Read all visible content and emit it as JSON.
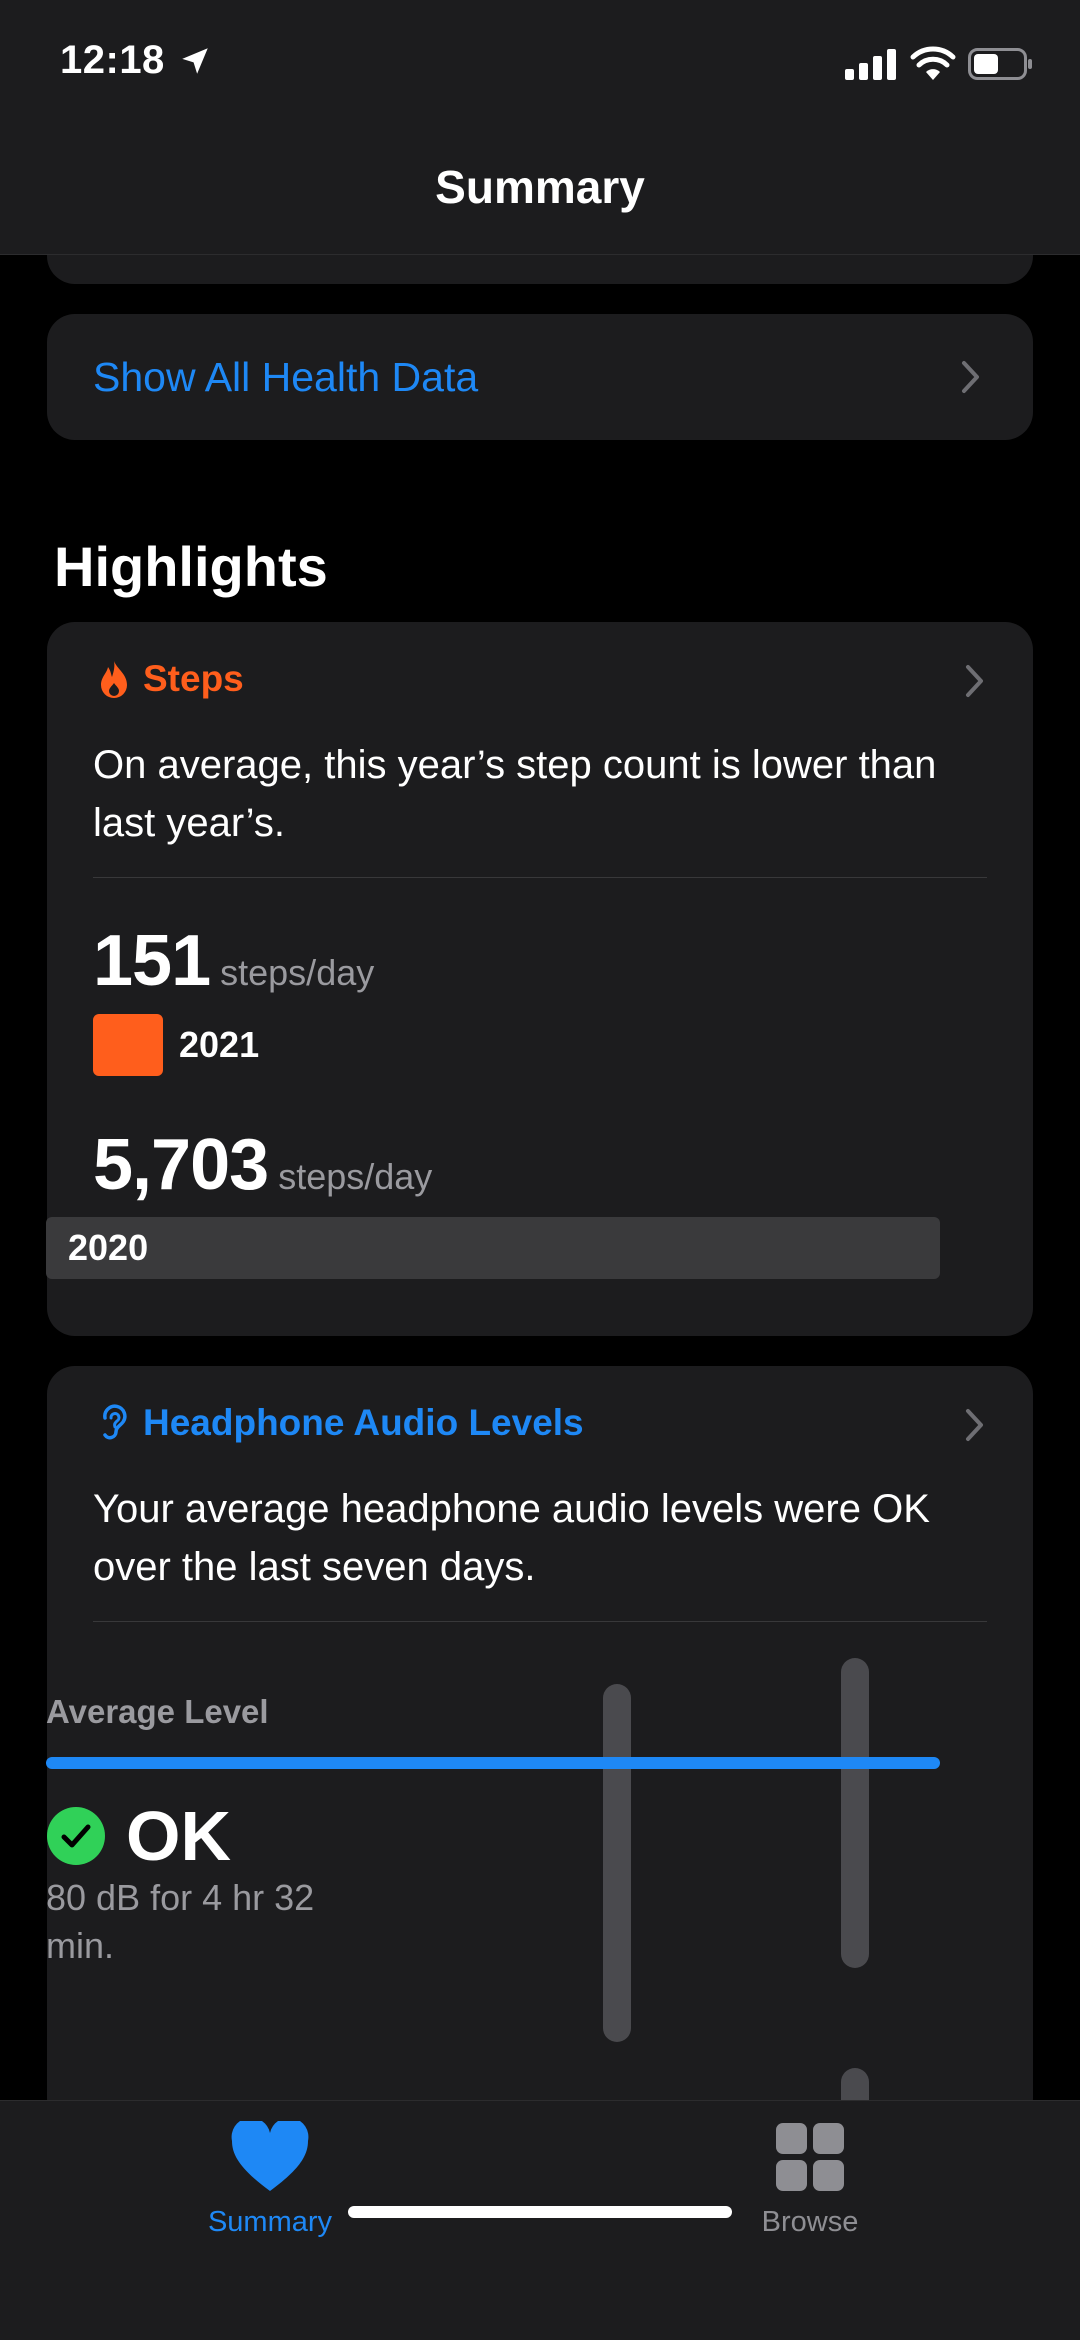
{
  "status_bar": {
    "time": "12:18"
  },
  "nav": {
    "title": "Summary"
  },
  "show_all": {
    "label": "Show All Health Data"
  },
  "highlights": {
    "title": "Highlights",
    "steps": {
      "title": "Steps",
      "description": "On average, this year’s step count is lower than last year’s.",
      "current": {
        "value": "151",
        "unit": "steps/day",
        "year": "2021"
      },
      "previous": {
        "value": "5,703",
        "unit": "steps/day",
        "year": "2020"
      },
      "accent": "#ff5e1c"
    },
    "audio": {
      "title": "Headphone Audio Levels",
      "description": "Your average headphone audio levels were OK over the last seven days.",
      "average_label": "Average Level",
      "status": "OK",
      "detail": "80 dB for 4 hr 32 min.",
      "accent": "#1e88f5"
    }
  },
  "tabs": [
    {
      "label": "Summary",
      "icon": "heart-icon",
      "selected": true
    },
    {
      "label": "Browse",
      "icon": "grid-icon",
      "selected": false
    }
  ]
}
